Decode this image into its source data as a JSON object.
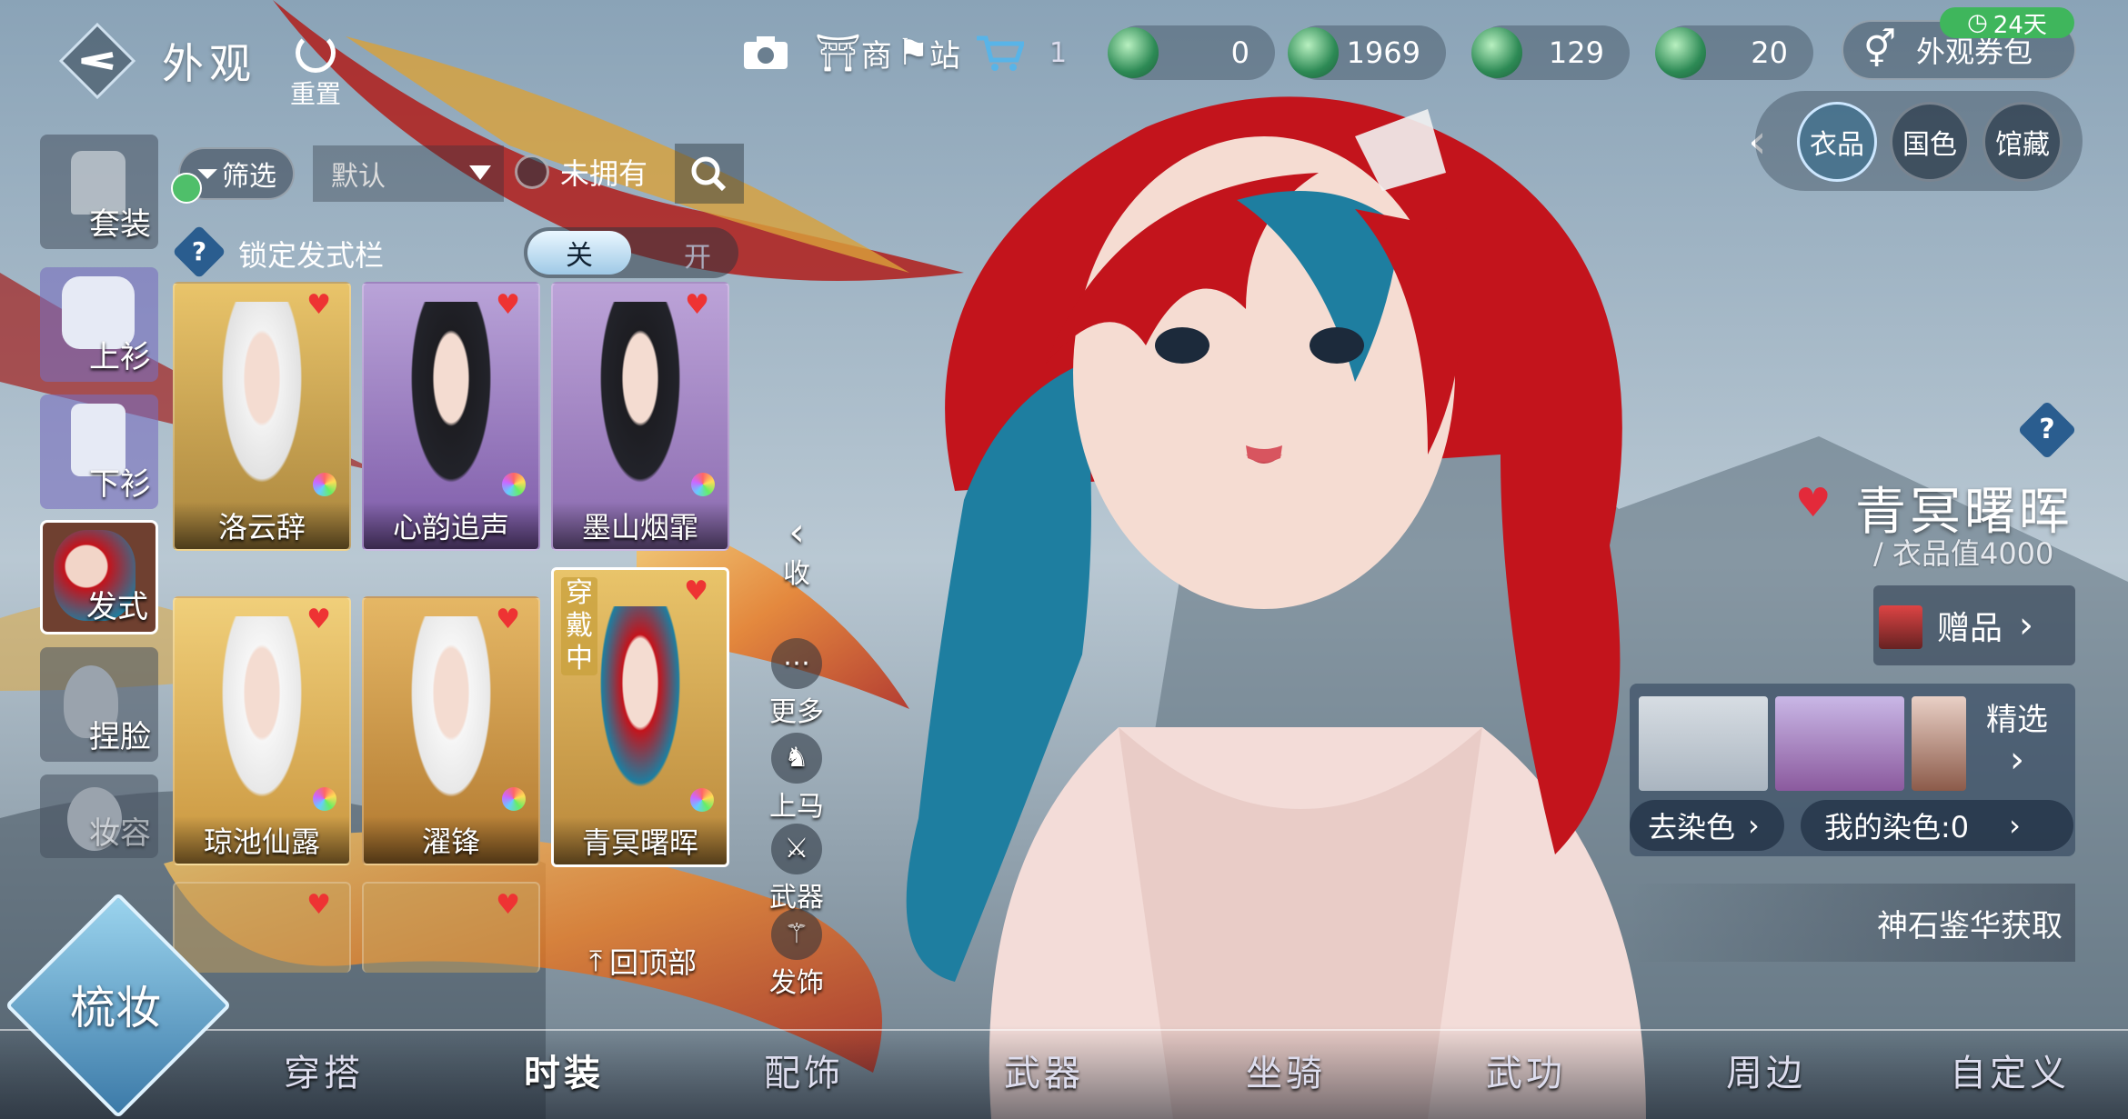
{
  "header": {
    "title": "外观",
    "reset_label": "重置",
    "shop_label": "商",
    "station_label": "站",
    "cart_count": "1",
    "currencies": [
      "0",
      "1969",
      "129",
      "20"
    ],
    "coupon_label": "外观券包",
    "coupon_days": "24天"
  },
  "right_tabs": [
    "衣品",
    "国色",
    "馆藏"
  ],
  "categories": [
    "套装",
    "上衫",
    "下衫",
    "发式",
    "捏脸",
    "妆容"
  ],
  "filter": {
    "filter_label": "筛选",
    "sort_value": "默认",
    "unowned_label": "未拥有"
  },
  "lock": {
    "help": "?",
    "label": "锁定发式栏",
    "off_label": "关",
    "on_label": "开"
  },
  "hairstyles": [
    {
      "name": "洛云辞"
    },
    {
      "name": "心韵追声"
    },
    {
      "name": "墨山烟霏"
    },
    {
      "name": "琼池仙露"
    },
    {
      "name": "濯锋"
    },
    {
      "name": "青冥曙晖",
      "status": "穿戴中"
    }
  ],
  "back_to_top": "回顶部",
  "tools": [
    "收",
    "更多",
    "上马",
    "武器",
    "发饰"
  ],
  "item": {
    "help": "?",
    "name": "青冥曙晖",
    "value_text": "/ 衣品值4000",
    "gift_label": "赠品",
    "picks_label": "精选",
    "dye_remove": "去染色",
    "dye_mine": "我的染色:0",
    "obtain": "神石鉴华获取"
  },
  "makeup_label": "梳妆",
  "bottom_nav": [
    "穿搭",
    "时装",
    "配饰",
    "武器",
    "坐骑",
    "武功",
    "周边",
    "自定义"
  ],
  "colors": {
    "accent": "#3fb65c",
    "heart": "#e32a3a",
    "selected_tab": "#cde7ff"
  }
}
